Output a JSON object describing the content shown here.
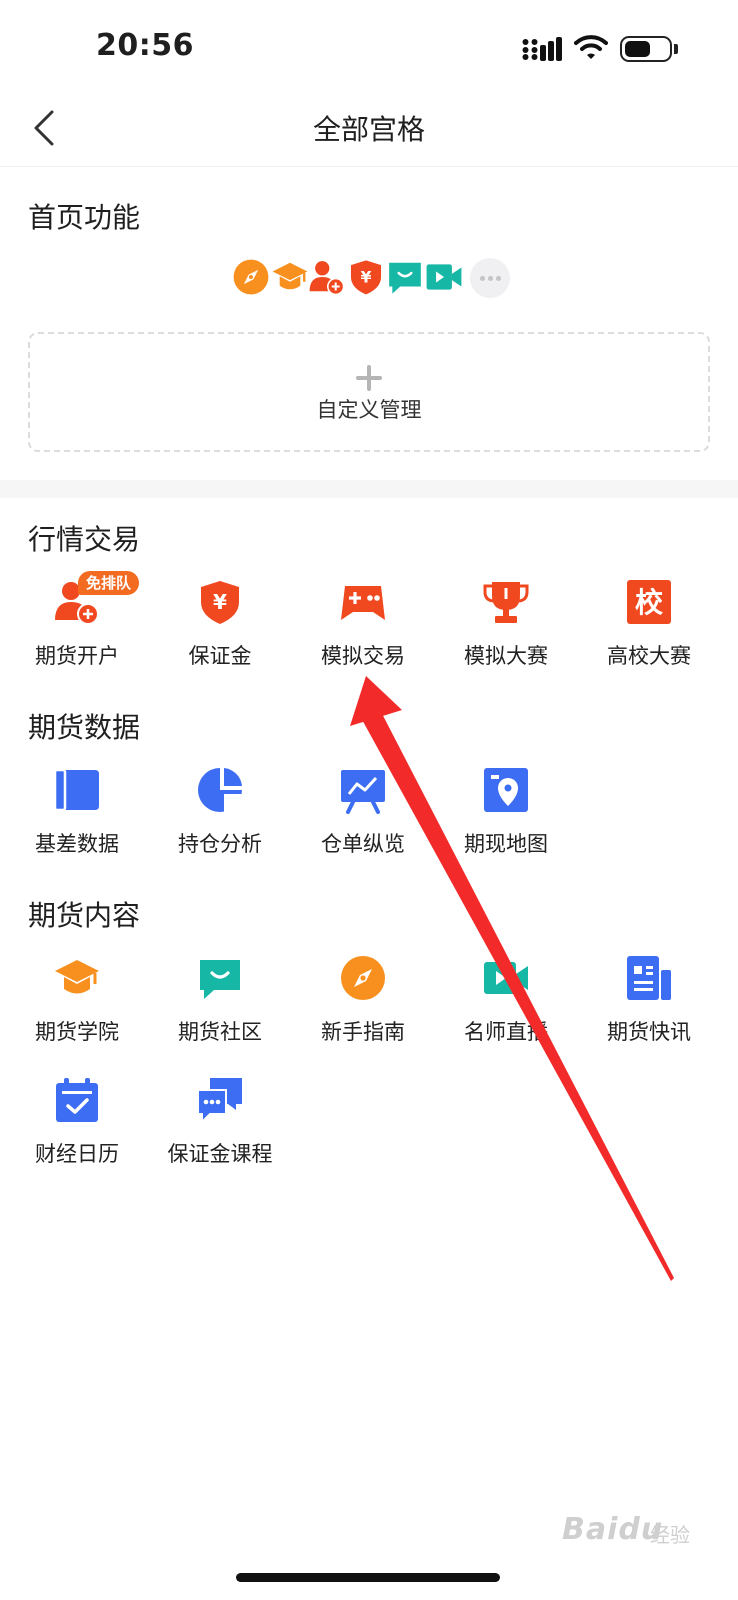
{
  "status_bar": {
    "time": "20:56",
    "battery_level": 0.6
  },
  "nav": {
    "title": "全部宫格",
    "back_icon": "chevron-left-icon"
  },
  "home_functions": {
    "title": "首页功能",
    "icons": [
      "compass-icon",
      "graduation-cap-icon",
      "user-add-icon",
      "shield-yen-icon",
      "chat-smile-icon",
      "video-icon"
    ],
    "more_icon": "more-dots-icon",
    "custom_label": "自定义管理"
  },
  "sections": {
    "trading": {
      "title": "行情交易",
      "items": [
        {
          "label": "期货开户",
          "icon": "user-add-icon",
          "badge": "免排队"
        },
        {
          "label": "保证金",
          "icon": "shield-yen-icon"
        },
        {
          "label": "模拟交易",
          "icon": "gamepad-icon"
        },
        {
          "label": "模拟大赛",
          "icon": "trophy-icon"
        },
        {
          "label": "高校大赛",
          "icon": "school-icon",
          "icon_text": "校"
        }
      ]
    },
    "data": {
      "title": "期货数据",
      "items": [
        {
          "label": "基差数据",
          "icon": "book-icon"
        },
        {
          "label": "持仓分析",
          "icon": "pie-chart-icon"
        },
        {
          "label": "仓单纵览",
          "icon": "presentation-chart-icon"
        },
        {
          "label": "期现地图",
          "icon": "map-pin-icon"
        }
      ]
    },
    "content": {
      "title": "期货内容",
      "items": [
        {
          "label": "期货学院",
          "icon": "graduation-cap-icon"
        },
        {
          "label": "期货社区",
          "icon": "chat-smile-icon"
        },
        {
          "label": "新手指南",
          "icon": "compass-icon"
        },
        {
          "label": "名师直播",
          "icon": "video-icon"
        },
        {
          "label": "期货快讯",
          "icon": "news-icon"
        },
        {
          "label": "财经日历",
          "icon": "calendar-check-icon"
        },
        {
          "label": "保证金课程",
          "icon": "chat-bubbles-icon"
        }
      ]
    }
  },
  "watermark": {
    "brand": "Baidu",
    "suffix": "经验"
  },
  "colors": {
    "orange": "#f7901e",
    "red": "#f0481f",
    "teal": "#17b7a6",
    "blue": "#3d6df2",
    "arrow": "#f22a2a"
  }
}
